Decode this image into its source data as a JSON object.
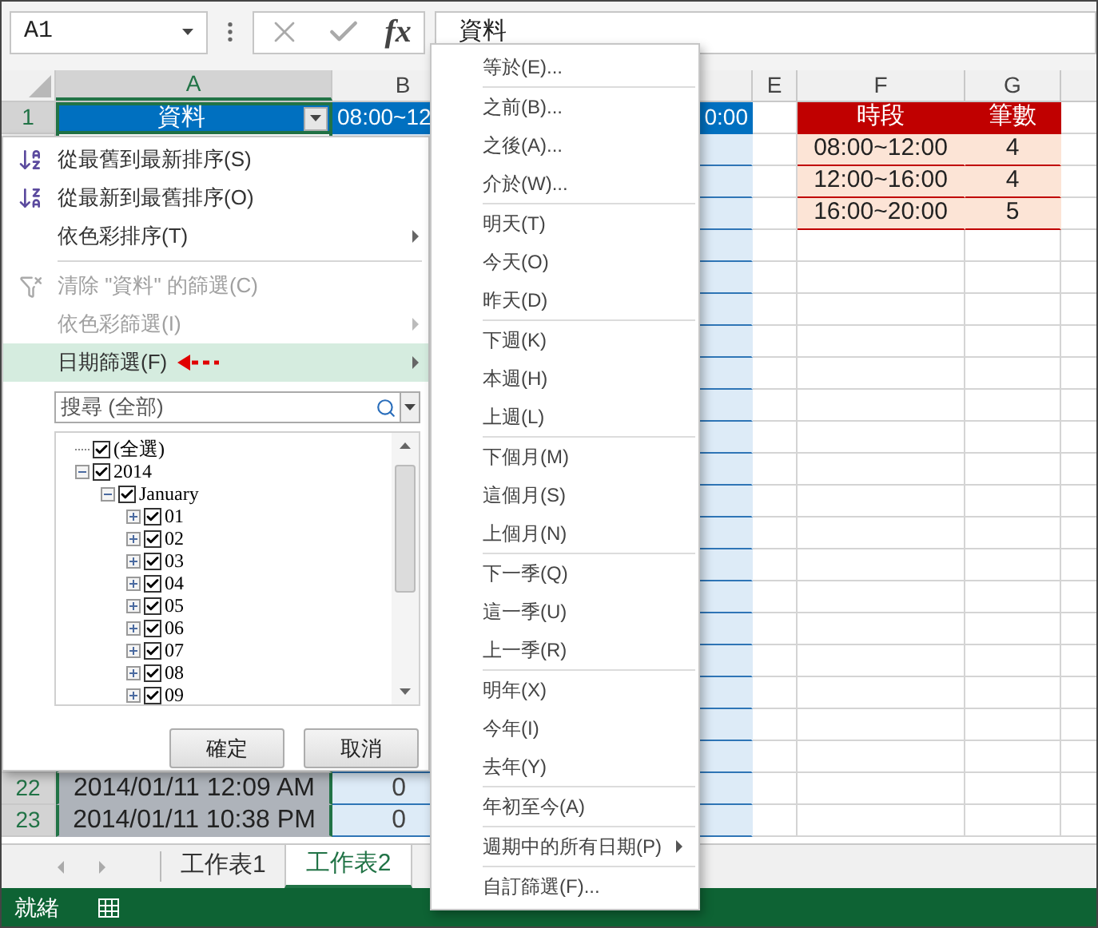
{
  "name_box": "A1",
  "formula_bar": {
    "fx_label": "fx",
    "value": "資料"
  },
  "columns": [
    {
      "label": "A",
      "selected": true
    },
    {
      "label": "B",
      "selected": false
    },
    {
      "label": "E",
      "selected": false
    },
    {
      "label": "F",
      "selected": false
    },
    {
      "label": "G",
      "selected": false
    }
  ],
  "header_row": {
    "row": "1",
    "selected": true,
    "column_a": "資料",
    "column_b": "08:00~12",
    "column_d": "0:00"
  },
  "summary_table": {
    "columns": [
      "時段",
      "筆數"
    ],
    "rows": [
      [
        "08:00~12:00",
        "4"
      ],
      [
        "12:00~16:00",
        "4"
      ],
      [
        "16:00~20:00",
        "5"
      ]
    ]
  },
  "rows": [
    {
      "row": "22",
      "selected": true,
      "date": "2014/01/11 12:09 AM",
      "value": "0"
    },
    {
      "row": "23",
      "selected": true,
      "date": "2014/01/11 10:38 PM",
      "value": "0"
    }
  ],
  "filter_menu": {
    "items": [
      {
        "kind": "sort-asc",
        "label": "從最舊到最新排序(S)",
        "disabled": false,
        "selected": false,
        "submenu": false
      },
      {
        "kind": "sort-desc",
        "label": "從最新到最舊排序(O)",
        "disabled": false,
        "selected": false,
        "submenu": false
      },
      {
        "kind": "plain",
        "label": "依色彩排序(T)",
        "disabled": false,
        "selected": false,
        "submenu": true
      },
      {
        "kind": "clear-filter",
        "label": "清除 \"資料\" 的篩選(C)",
        "disabled": true,
        "selected": false,
        "submenu": false
      },
      {
        "kind": "plain",
        "label": "依色彩篩選(I)",
        "disabled": true,
        "selected": false,
        "submenu": true
      },
      {
        "kind": "plain",
        "label": "日期篩選(F)",
        "disabled": false,
        "selected": true,
        "submenu": true
      }
    ],
    "search": {
      "placeholder": "搜尋 (全部)"
    },
    "tree": [
      {
        "label": "(全選)",
        "checked": true
      },
      {
        "label": "2014",
        "checked": true,
        "expanded": true,
        "children": [
          {
            "label": "January",
            "checked": true,
            "expanded": true,
            "children": [
              {
                "label": "01",
                "checked": true,
                "expanded": false
              },
              {
                "label": "02",
                "checked": true,
                "expanded": false
              },
              {
                "label": "03",
                "checked": true,
                "expanded": false
              },
              {
                "label": "04",
                "checked": true,
                "expanded": false
              },
              {
                "label": "05",
                "checked": true,
                "expanded": false
              },
              {
                "label": "06",
                "checked": true,
                "expanded": false
              },
              {
                "label": "07",
                "checked": true,
                "expanded": false
              },
              {
                "label": "08",
                "checked": true,
                "expanded": false
              },
              {
                "label": "09",
                "checked": true,
                "expanded": false
              }
            ]
          }
        ]
      }
    ],
    "buttons": [
      "確定",
      "取消"
    ]
  },
  "date_filter_menu": {
    "groups": [
      [
        {
          "label": "等於(E)...",
          "submenu": false
        }
      ],
      [
        {
          "label": "之前(B)...",
          "submenu": false
        },
        {
          "label": "之後(A)...",
          "submenu": false
        },
        {
          "label": "介於(W)...",
          "submenu": false
        }
      ],
      [
        {
          "label": "明天(T)",
          "submenu": false
        },
        {
          "label": "今天(O)",
          "submenu": false
        },
        {
          "label": "昨天(D)",
          "submenu": false
        }
      ],
      [
        {
          "label": "下週(K)",
          "submenu": false
        },
        {
          "label": "本週(H)",
          "submenu": false
        },
        {
          "label": "上週(L)",
          "submenu": false
        }
      ],
      [
        {
          "label": "下個月(M)",
          "submenu": false
        },
        {
          "label": "這個月(S)",
          "submenu": false
        },
        {
          "label": "上個月(N)",
          "submenu": false
        }
      ],
      [
        {
          "label": "下一季(Q)",
          "submenu": false
        },
        {
          "label": "這一季(U)",
          "submenu": false
        },
        {
          "label": "上一季(R)",
          "submenu": false
        }
      ],
      [
        {
          "label": "明年(X)",
          "submenu": false
        },
        {
          "label": "今年(I)",
          "submenu": false
        },
        {
          "label": "去年(Y)",
          "submenu": false
        }
      ],
      [
        {
          "label": "年初至今(A)",
          "submenu": false
        }
      ],
      [
        {
          "label": "週期中的所有日期(P)",
          "submenu": true
        }
      ],
      [
        {
          "label": "自訂篩選(F)...",
          "submenu": false
        }
      ]
    ]
  },
  "sheet_tabs": [
    {
      "label": "工作表1",
      "selected": false
    },
    {
      "label": "工作表2",
      "selected": true
    }
  ],
  "status_bar": {
    "text": "就緒"
  }
}
